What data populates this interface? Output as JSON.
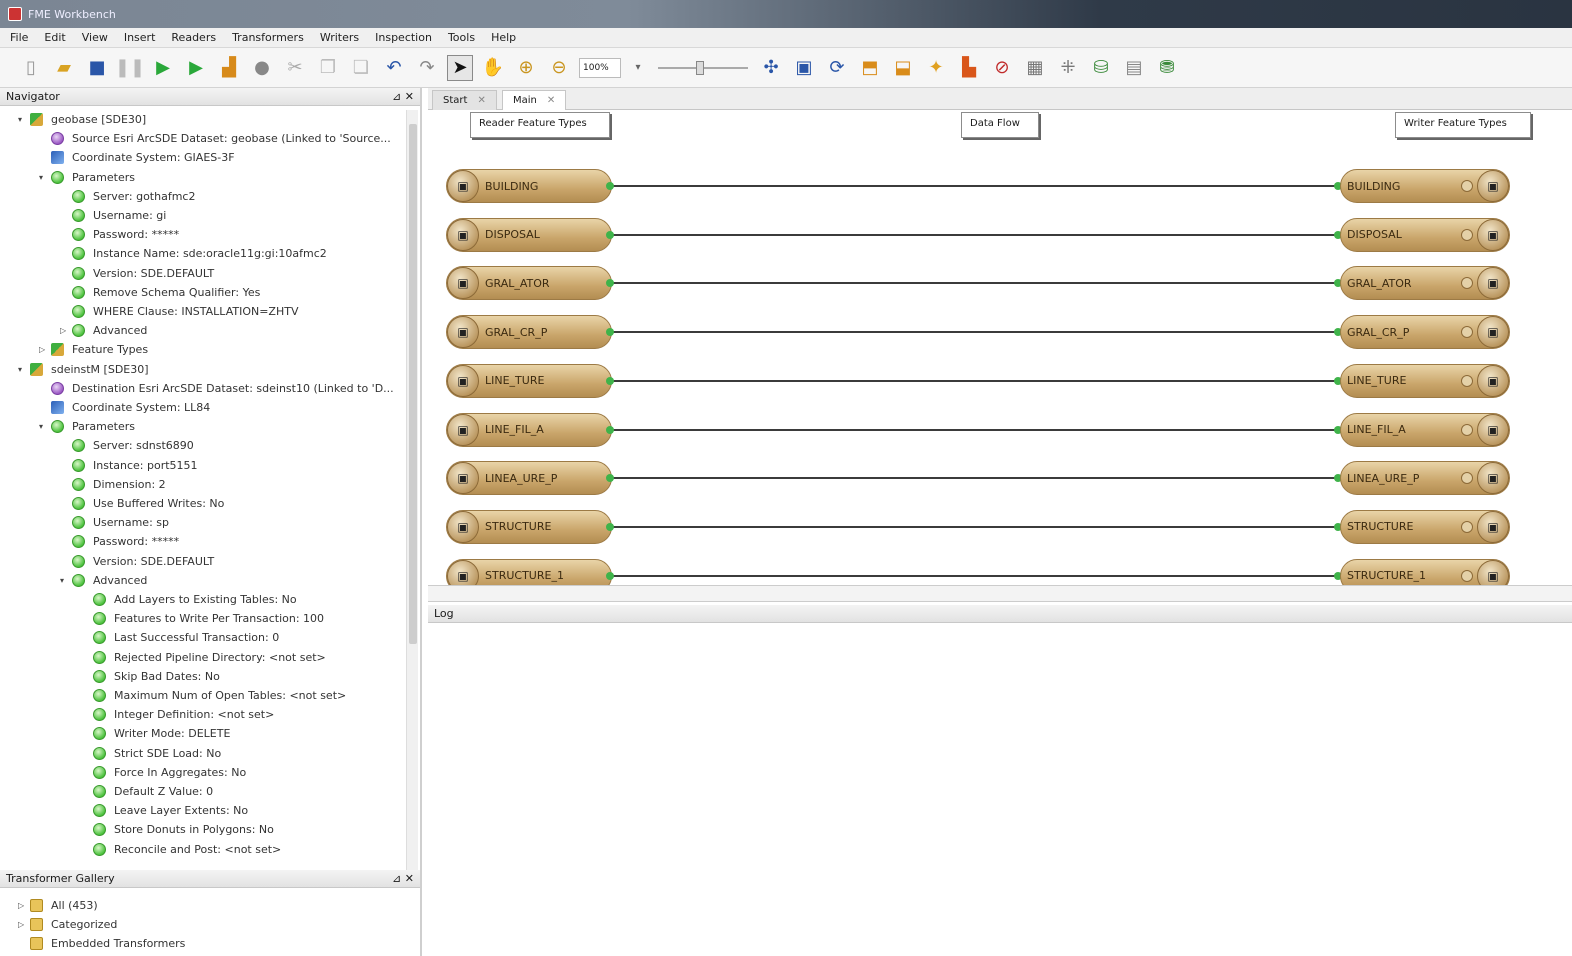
{
  "window": {
    "title": "FME Workbench"
  },
  "menu": [
    "File",
    "Edit",
    "View",
    "Insert",
    "Readers",
    "Transformers",
    "Writers",
    "Inspection",
    "Tools",
    "Help"
  ],
  "toolbar": {
    "zoom": "100%"
  },
  "navigator": {
    "title": "Navigator",
    "nodes": [
      {
        "label": "geobase [SDE30]",
        "icon": "reader"
      },
      {
        "label": "Source Esri ArcSDE Dataset: geobase (Linked to 'Source...",
        "icon": "src"
      },
      {
        "label": "Coordinate System: GIAES-3F",
        "icon": "coord"
      },
      {
        "label": "Parameters",
        "icon": "param"
      },
      {
        "label": "Server: gothafmc2",
        "icon": "param"
      },
      {
        "label": "Username: gi",
        "icon": "param"
      },
      {
        "label": "Password: *****",
        "icon": "param"
      },
      {
        "label": "Instance Name: sde:oracle11g:gi:10afmc2",
        "icon": "param"
      },
      {
        "label": "Version: SDE.DEFAULT",
        "icon": "param"
      },
      {
        "label": "Remove Schema Qualifier: Yes",
        "icon": "param"
      },
      {
        "label": "WHERE Clause: INSTALLATION=ZHTV",
        "icon": "param"
      },
      {
        "label": "Advanced",
        "icon": "param"
      },
      {
        "label": "Feature Types",
        "icon": "reader"
      },
      {
        "label": "sdeinstM [SDE30]",
        "icon": "reader"
      },
      {
        "label": "Destination Esri ArcSDE Dataset: sdeinst10 (Linked to 'D...",
        "icon": "src"
      },
      {
        "label": "Coordinate System: LL84",
        "icon": "coord"
      },
      {
        "label": "Parameters",
        "icon": "param"
      },
      {
        "label": "Server: sdnst6890",
        "icon": "param"
      },
      {
        "label": "Instance: port5151",
        "icon": "param"
      },
      {
        "label": "Dimension: 2",
        "icon": "param"
      },
      {
        "label": "Use Buffered Writes: No",
        "icon": "param"
      },
      {
        "label": "Username: sp",
        "icon": "param"
      },
      {
        "label": "Password: *****",
        "icon": "param"
      },
      {
        "label": "Version: SDE.DEFAULT",
        "icon": "param"
      },
      {
        "label": "Advanced",
        "icon": "param"
      },
      {
        "label": "Add Layers to Existing Tables: No",
        "icon": "param"
      },
      {
        "label": "Features to Write Per Transaction: 100",
        "icon": "param"
      },
      {
        "label": "Last Successful Transaction: 0",
        "icon": "param"
      },
      {
        "label": "Rejected Pipeline Directory: <not set>",
        "icon": "param"
      },
      {
        "label": "Skip Bad Dates: No",
        "icon": "param"
      },
      {
        "label": "Maximum Num of Open Tables: <not set>",
        "icon": "param"
      },
      {
        "label": "Integer Definition: <not set>",
        "icon": "param"
      },
      {
        "label": "Writer Mode: DELETE",
        "icon": "param"
      },
      {
        "label": "Strict SDE Load: No",
        "icon": "param"
      },
      {
        "label": "Force In Aggregates: No",
        "icon": "param"
      },
      {
        "label": "Default Z Value: 0",
        "icon": "param"
      },
      {
        "label": "Leave Layer Extents: No",
        "icon": "param"
      },
      {
        "label": "Store Donuts in Polygons: No",
        "icon": "param"
      },
      {
        "label": "Reconcile and Post: <not set>",
        "icon": "param"
      }
    ]
  },
  "gallery": {
    "title": "Transformer Gallery",
    "items": [
      "All (453)",
      "Categorized",
      "Embedded Transformers"
    ]
  },
  "tabs": [
    "Start",
    "Main"
  ],
  "canvas": {
    "bookmarks": [
      "Reader Feature Types",
      "Data Flow",
      "Writer Feature Types"
    ],
    "features": [
      "BUILDING",
      "DISPOSAL",
      "GRAL_ATOR",
      "GRAL_CR_P",
      "LINE_TURE",
      "LINE_FIL_A",
      "LINEA_URE_P",
      "STRUCTURE",
      "STRUCTURE_1"
    ]
  },
  "log": {
    "title": "Log"
  }
}
